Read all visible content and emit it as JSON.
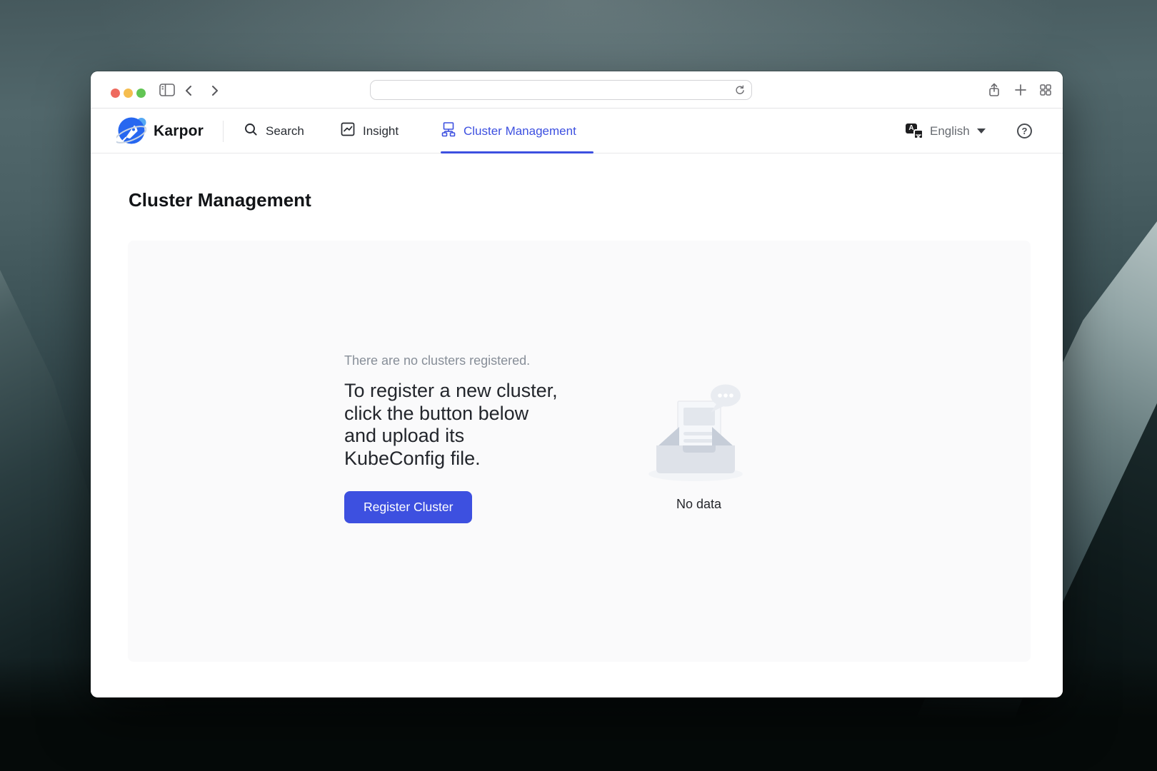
{
  "chrome": {
    "address_value": "",
    "icons": [
      "sidebar-toggle",
      "back",
      "forward",
      "reload",
      "share",
      "new-tab",
      "tab-overview"
    ],
    "traffic_light_colors": [
      "#EE6A5F",
      "#F5BD4F",
      "#62C554"
    ]
  },
  "nav": {
    "brand": "Karpor",
    "tabs": [
      {
        "label": "Search",
        "active": false
      },
      {
        "label": "Insight",
        "active": false
      },
      {
        "label": "Cluster Management",
        "active": true
      }
    ],
    "language": {
      "label": "English",
      "icon_primary": "A"
    },
    "help_glyph": "?"
  },
  "page": {
    "title": "Cluster Management",
    "empty": {
      "subtitle": "There are no clusters registered.",
      "lines": [
        "To register a new cluster,",
        "click the button below",
        "and upload its",
        "KubeConfig file."
      ],
      "button_label": "Register Cluster",
      "no_data_label": "No data"
    }
  },
  "colors": {
    "accent": "#3D50E0",
    "nav_text": "#292D33",
    "muted_text": "#878E98",
    "card_bg": "#FAFAFB"
  }
}
